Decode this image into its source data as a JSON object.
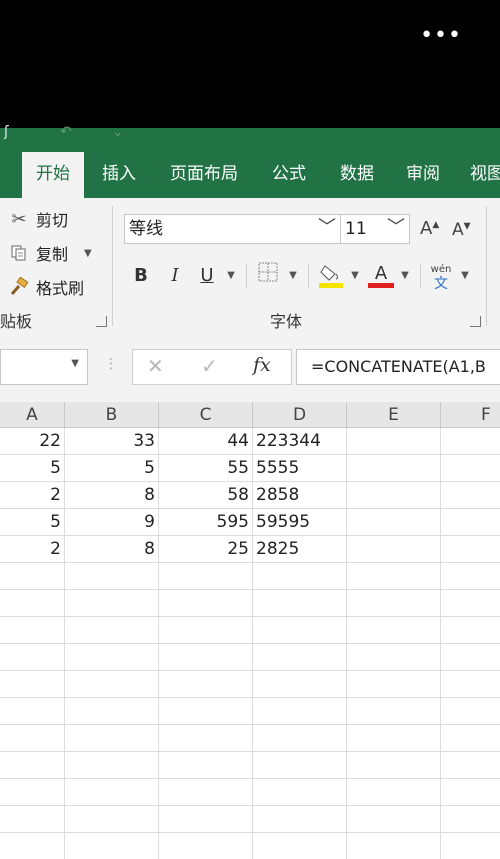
{
  "window": {
    "menu_dots": "•••"
  },
  "quick_access": {
    "left_glyph": "ʃ",
    "undo_glyph": "↶",
    "more_glyph": "⌄"
  },
  "ribbon_tabs": [
    "开始",
    "插入",
    "页面布局",
    "公式",
    "数据",
    "审阅",
    "视图"
  ],
  "active_tab": "开始",
  "clipboard": {
    "cut_label": "剪切",
    "copy_label": "复制",
    "format_painter_label": "格式刷",
    "group_label": "贴板"
  },
  "font_group": {
    "font_name": "等线",
    "font_size": "11",
    "grow_label": "A",
    "shrink_label": "A",
    "bold_label": "B",
    "italic_label": "I",
    "underline_label": "U",
    "font_color_label": "A",
    "phonetic_top": "wén",
    "phonetic_bottom": "文",
    "group_label": "字体",
    "font_color": "#e02020",
    "fill_color": "#f5e400"
  },
  "formula_bar": {
    "name_box": "",
    "cancel_glyph": "✕",
    "enter_glyph": "✓",
    "fx_label": "fx",
    "formula": "=CONCATENATE(A1,B"
  },
  "grid": {
    "columns": [
      "A",
      "B",
      "C",
      "D",
      "E",
      "F"
    ],
    "rows": [
      [
        "22",
        "33",
        "44",
        "223344",
        "",
        ""
      ],
      [
        "5",
        "5",
        "55",
        "5555",
        "",
        ""
      ],
      [
        "2",
        "8",
        "58",
        "2858",
        "",
        ""
      ],
      [
        "5",
        "9",
        "595",
        "59595",
        "",
        ""
      ],
      [
        "2",
        "8",
        "25",
        "2825",
        "",
        ""
      ]
    ]
  },
  "colors": {
    "excel_green": "#217346"
  }
}
